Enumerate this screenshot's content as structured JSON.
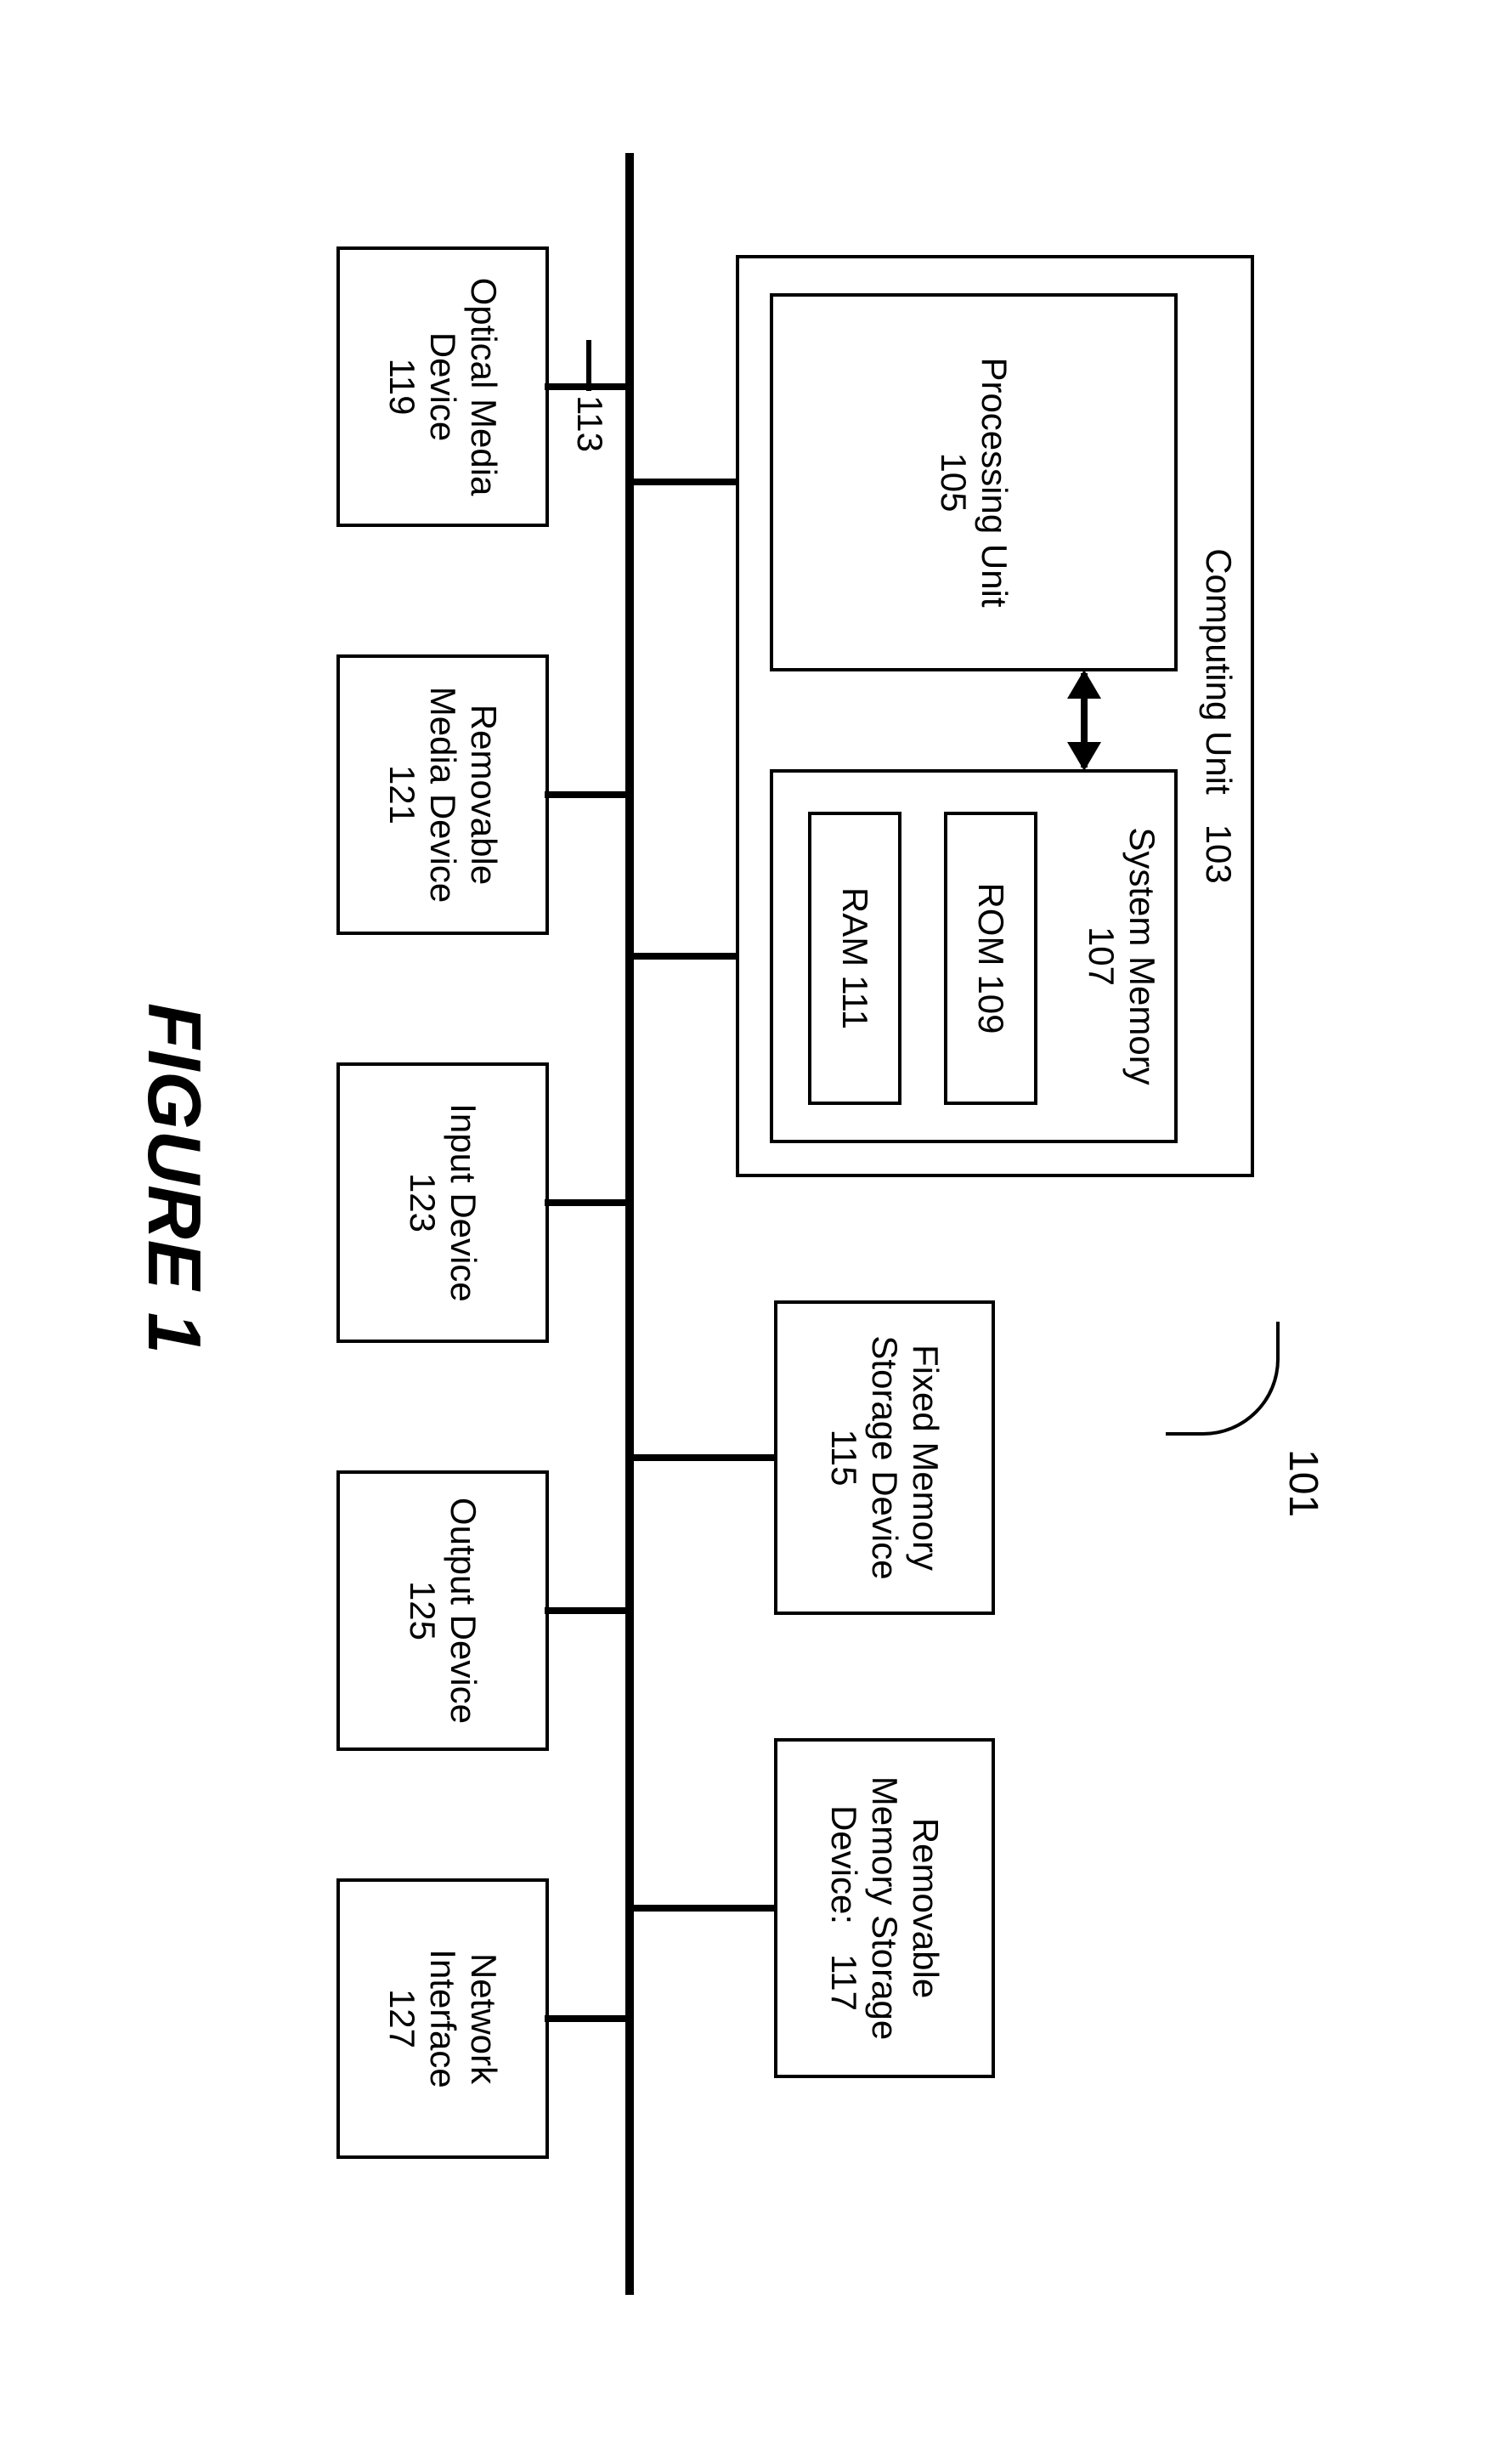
{
  "figure_caption": "FIGURE 1",
  "system_ref": "101",
  "bus_ref": "113",
  "computing_unit": {
    "label": "Computing Unit",
    "ref": "103"
  },
  "processing_unit": {
    "label": "Processing Unit",
    "ref": "105"
  },
  "system_memory": {
    "label": "System Memory",
    "ref": "107"
  },
  "rom": {
    "label": "ROM",
    "ref": "109"
  },
  "ram": {
    "label": "RAM",
    "ref": "111"
  },
  "fixed_memory": {
    "l1": "Fixed Memory",
    "l2": "Storage Device",
    "ref": "115"
  },
  "removable_memory": {
    "l1": "Removable",
    "l2": "Memory Storage",
    "l3": "Device:",
    "ref": "117"
  },
  "optical_media": {
    "l1": "Optical Media",
    "l2": "Device",
    "ref": "119"
  },
  "removable_media": {
    "l1": "Removable",
    "l2": "Media Device",
    "ref": "121"
  },
  "input_device": {
    "l1": "Input Device",
    "ref": "123"
  },
  "output_device": {
    "l1": "Output Device",
    "ref": "125"
  },
  "network_interface": {
    "l1": "Network",
    "l2": "Interface",
    "ref": "127"
  }
}
